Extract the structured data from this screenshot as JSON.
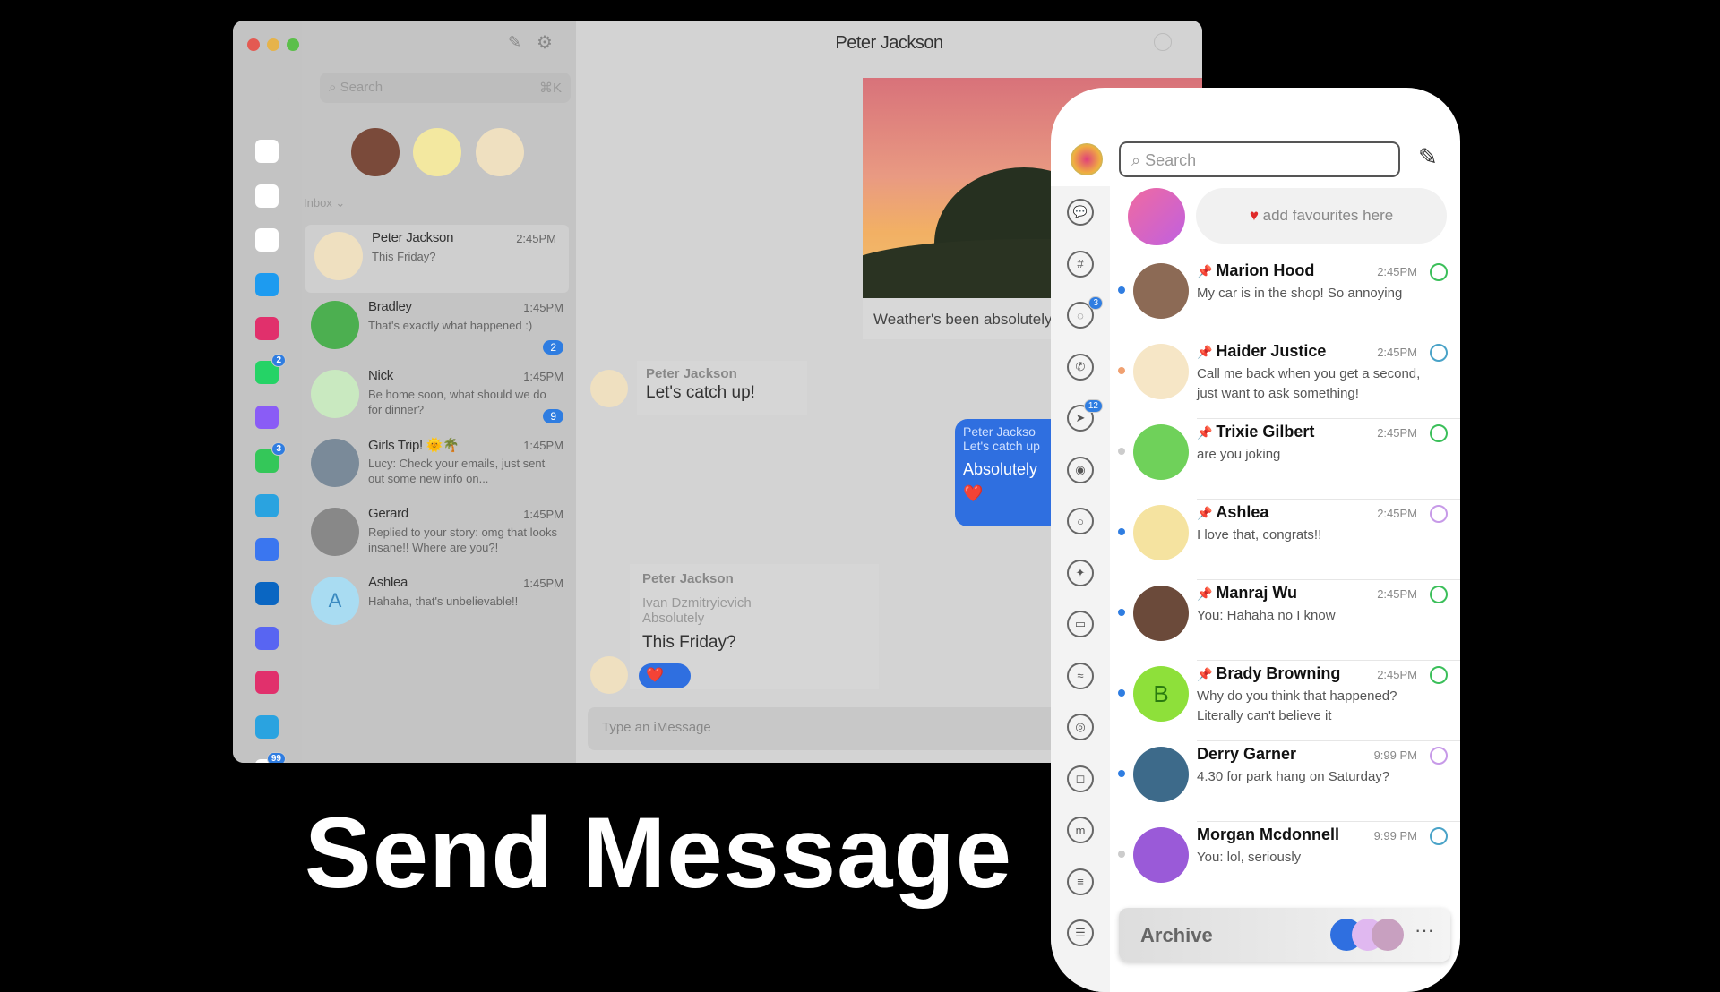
{
  "desktop": {
    "title": "Peter Jackson",
    "search_placeholder": "Search",
    "search_shortcut": "⌘K",
    "inbox_label": "Inbox",
    "rail": [
      {
        "icon": "layers-icon",
        "color": "#c3c3c3"
      },
      {
        "icon": "chats-icon",
        "color": "#ffffff"
      },
      {
        "icon": "inbox-icon",
        "color": "#ffffff"
      },
      {
        "icon": "trend-icon",
        "color": "#ffffff"
      },
      {
        "icon": "twitter-icon",
        "color": "#1d9bf0"
      },
      {
        "icon": "instagram-icon",
        "color": "#e1306c"
      },
      {
        "icon": "whatsapp-icon",
        "color": "#25d366",
        "badge": "2"
      },
      {
        "icon": "messenger-icon",
        "color": "#8a5cf6"
      },
      {
        "icon": "imessage-icon",
        "color": "#34c759",
        "badge": "3"
      },
      {
        "icon": "telegram-icon",
        "color": "#2aa3e0"
      },
      {
        "icon": "signal-icon",
        "color": "#3a76f0"
      },
      {
        "icon": "linkedin-icon",
        "color": "#0a66c2"
      },
      {
        "icon": "discord-icon",
        "color": "#5865f2"
      },
      {
        "icon": "instagram-icon",
        "color": "#e1306c"
      },
      {
        "icon": "telegram-icon",
        "color": "#2aa3e0"
      },
      {
        "icon": "slack-icon",
        "color": "#ffffff",
        "badge": "99"
      }
    ],
    "conversations": [
      {
        "name": "Peter Jackson",
        "time": "2:45PM",
        "message": "This Friday?",
        "avatar": "#efe0c0",
        "selected": true
      },
      {
        "name": "Bradley",
        "time": "1:45PM",
        "message": "That's exactly what happened :)",
        "count": "2",
        "avatar": "#4caf50"
      },
      {
        "name": "Nick",
        "time": "1:45PM",
        "message": "Be home soon, what should we do for dinner?",
        "count": "9",
        "avatar": "#c9e9c0"
      },
      {
        "name": "Girls Trip! 🌞🌴",
        "time": "1:45PM",
        "message": "Lucy: Check your emails, just sent out some new info on...",
        "avatar": "#7a8a99"
      },
      {
        "name": "Gerard",
        "time": "1:45PM",
        "message": "Replied to your story: omg that looks insane!! Where are you?!",
        "avatar": "#888888"
      },
      {
        "name": "Ashlea",
        "time": "1:45PM",
        "message": "Hahaha, that's unbelievable!!",
        "avatar": "#a9dcf2",
        "initial": "A"
      }
    ],
    "chat": {
      "caption": "Weather's been absolutely beautiful here",
      "msg1_sender": "Peter Jackson",
      "msg1_text": "Let's catch up!",
      "reply_quote_name": "Peter Jackso",
      "reply_quote_text": "Let's catch up",
      "reply_text": "Absolutely",
      "msg2_sender": "Peter Jackson",
      "msg2_quote_name": "Ivan Dzmitryievich",
      "msg2_quote_text": "Absolutely",
      "msg2_text": "This Friday?",
      "input_placeholder": "Type an  iMessage"
    }
  },
  "phone": {
    "search_placeholder": "Search",
    "favourites_text": "add favourites here",
    "rail_badges": {
      "2": "3",
      "4": "12"
    },
    "rail_icons": [
      "chats-icon",
      "slack-icon",
      "dashed-circle-icon",
      "whatsapp-icon",
      "telegram-icon",
      "discord-icon",
      "imessage-icon",
      "twitter-icon",
      "chat-bubble-icon",
      "messenger-icon",
      "game-icon",
      "instagram-icon",
      "matrix-icon",
      "sms-icon",
      "list-icon"
    ],
    "conversations": [
      {
        "name": "Marion Hood",
        "time": "2:45PM",
        "message": "My car is in the shop! So annoying",
        "source": "whatsapp",
        "src_color": "#3bbf5a",
        "dot": "#2f7de1",
        "avatar": "#8c6a55",
        "pinned": true
      },
      {
        "name": "Haider Justice",
        "time": "2:45PM",
        "message": "Call me back when you get a second, just want to ask something!",
        "source": "telegram",
        "src_color": "#4aa3c8",
        "dot": "#f0a070",
        "avatar": "#f6e6c6",
        "pinned": true
      },
      {
        "name": "Trixie Gilbert",
        "time": "2:45PM",
        "message": "are you joking",
        "source": "whatsapp",
        "src_color": "#3bbf5a",
        "dot": "#cccccc",
        "avatar": "#6fd15a",
        "pinned": true
      },
      {
        "name": "Ashlea",
        "time": "2:45PM",
        "message": "I love that, congrats!!",
        "source": "messenger",
        "src_color": "#c79ae8",
        "dot": "#2f7de1",
        "avatar": "#f5e3a0",
        "pinned": true
      },
      {
        "name": "Manraj Wu",
        "time": "2:45PM",
        "message": "You: Hahaha no I know",
        "source": "whatsapp",
        "src_color": "#3bbf5a",
        "dot": "#2f7de1",
        "avatar": "#6b4a3a",
        "pinned": true
      },
      {
        "name": "Brady Browning",
        "time": "2:45PM",
        "message": "Why do you think that happened? Literally can't believe it",
        "source": "imessage",
        "src_color": "#3bbf5a",
        "dot": "#2f7de1",
        "avatar": "#8ee03a",
        "initial": "B",
        "pinned": true
      },
      {
        "name": "Derry Garner",
        "time": "9:99 PM",
        "message": "4.30 for park hang on Saturday?",
        "source": "messenger",
        "src_color": "#c79ae8",
        "dot": "#2f7de1",
        "avatar": "#3d6a8a"
      },
      {
        "name": "Morgan Mcdonnell",
        "time": "9:99 PM",
        "message": "You: lol, seriously",
        "source": "telegram",
        "src_color": "#4aa3c8",
        "dot": "#cccccc",
        "avatar": "#9a5ad8"
      }
    ],
    "archive_label": "Archive",
    "more_label": "···"
  },
  "caption": "Send Message"
}
